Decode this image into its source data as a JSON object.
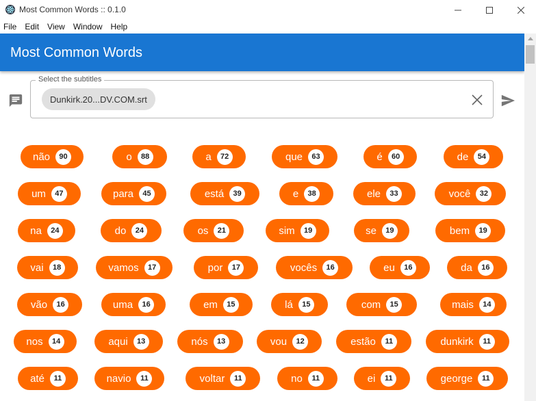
{
  "window": {
    "title": "Most Common Words :: 0.1.0"
  },
  "menu": [
    "File",
    "Edit",
    "View",
    "Window",
    "Help"
  ],
  "header": {
    "title": "Most Common Words"
  },
  "selector": {
    "legend": "Select the subtitles",
    "file": "Dunkirk.20...DV.COM.srt"
  },
  "colors": {
    "appbar": "#1976d2",
    "chip": "#ff6a00"
  },
  "words": [
    {
      "word": "não",
      "count": "90"
    },
    {
      "word": "o",
      "count": "88"
    },
    {
      "word": "a",
      "count": "72"
    },
    {
      "word": "que",
      "count": "63"
    },
    {
      "word": "é",
      "count": "60"
    },
    {
      "word": "de",
      "count": "54"
    },
    {
      "word": "um",
      "count": "47"
    },
    {
      "word": "para",
      "count": "45"
    },
    {
      "word": "está",
      "count": "39"
    },
    {
      "word": "e",
      "count": "38"
    },
    {
      "word": "ele",
      "count": "33"
    },
    {
      "word": "você",
      "count": "32"
    },
    {
      "word": "na",
      "count": "24"
    },
    {
      "word": "do",
      "count": "24"
    },
    {
      "word": "os",
      "count": "21"
    },
    {
      "word": "sim",
      "count": "19"
    },
    {
      "word": "se",
      "count": "19"
    },
    {
      "word": "bem",
      "count": "19"
    },
    {
      "word": "vai",
      "count": "18"
    },
    {
      "word": "vamos",
      "count": "17"
    },
    {
      "word": "por",
      "count": "17"
    },
    {
      "word": "vocês",
      "count": "16"
    },
    {
      "word": "eu",
      "count": "16"
    },
    {
      "word": "da",
      "count": "16"
    },
    {
      "word": "vão",
      "count": "16"
    },
    {
      "word": "uma",
      "count": "16"
    },
    {
      "word": "em",
      "count": "15"
    },
    {
      "word": "lá",
      "count": "15"
    },
    {
      "word": "com",
      "count": "15"
    },
    {
      "word": "mais",
      "count": "14"
    },
    {
      "word": "nos",
      "count": "14"
    },
    {
      "word": "aqui",
      "count": "13"
    },
    {
      "word": "nós",
      "count": "13"
    },
    {
      "word": "vou",
      "count": "12"
    },
    {
      "word": "estão",
      "count": "11"
    },
    {
      "word": "dunkirk",
      "count": "11"
    },
    {
      "word": "até",
      "count": "11"
    },
    {
      "word": "navio",
      "count": "11"
    },
    {
      "word": "voltar",
      "count": "11"
    },
    {
      "word": "no",
      "count": "11"
    },
    {
      "word": "ei",
      "count": "11"
    },
    {
      "word": "george",
      "count": "11"
    }
  ]
}
